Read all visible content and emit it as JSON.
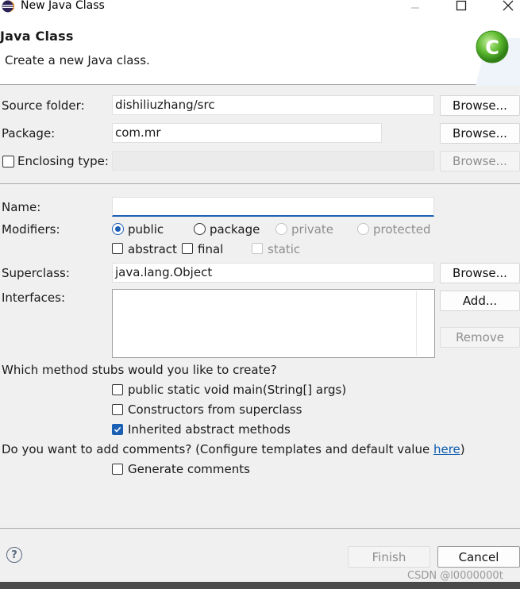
{
  "window": {
    "title": "New Java Class"
  },
  "header": {
    "title": "Java Class",
    "subtitle": "Create a new Java class."
  },
  "form": {
    "source_folder": {
      "label": "Source folder:",
      "value": "dishiliuzhang/src",
      "browse": "Browse..."
    },
    "package": {
      "label": "Package:",
      "value": "com.mr",
      "browse": "Browse..."
    },
    "enclosing_type": {
      "label": "Enclosing type:",
      "value": "",
      "browse": "Browse...",
      "checked": false
    },
    "name": {
      "label": "Name:",
      "value": ""
    },
    "modifiers": {
      "label": "Modifiers:",
      "access": [
        {
          "label": "public",
          "selected": true,
          "enabled": true
        },
        {
          "label": "package",
          "selected": false,
          "enabled": true
        },
        {
          "label": "private",
          "selected": false,
          "enabled": false
        },
        {
          "label": "protected",
          "selected": false,
          "enabled": false
        }
      ],
      "flags": [
        {
          "label": "abstract",
          "checked": false,
          "enabled": true
        },
        {
          "label": "final",
          "checked": false,
          "enabled": true
        },
        {
          "label": "static",
          "checked": false,
          "enabled": false
        }
      ]
    },
    "superclass": {
      "label": "Superclass:",
      "value": "java.lang.Object",
      "browse": "Browse..."
    },
    "interfaces": {
      "label": "Interfaces:",
      "add": "Add...",
      "remove": "Remove"
    },
    "stubs": {
      "question": "Which method stubs would you like to create?",
      "options": [
        {
          "label": "public static void main(String[] args)",
          "checked": false
        },
        {
          "label": "Constructors from superclass",
          "checked": false
        },
        {
          "label": "Inherited abstract methods",
          "checked": true
        }
      ]
    },
    "comments": {
      "question": "Do you want to add comments? (Configure templates and default value ",
      "link": "here",
      "suffix": ")",
      "option": {
        "label": "Generate comments",
        "checked": false
      }
    }
  },
  "footer": {
    "finish": "Finish",
    "cancel": "Cancel",
    "help_symbol": "?"
  },
  "watermark": "CSDN @l0000000t",
  "colors": {
    "accent": "#1a5fb4",
    "link": "#0b5cad",
    "badge": "#5cb82e"
  }
}
